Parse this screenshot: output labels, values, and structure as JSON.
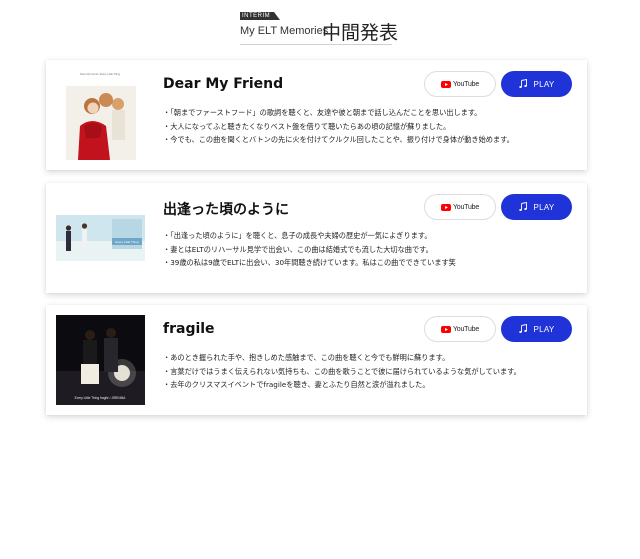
{
  "header": {
    "tag": "INTERIM",
    "subtitle": "My ELT Memories",
    "title": "中間発表"
  },
  "buttons": {
    "youtube_label": "YouTube",
    "play_label": "PLAY"
  },
  "colors": {
    "play_button": "#1f33d9",
    "youtube_red": "#ff0000"
  },
  "songs": [
    {
      "title": "Dear My Friend",
      "jacket_caption": "Dear My Friend / Every Little Thing",
      "memories": [
        "・「朝までファーストフード」の歌詞を聴くと、友達や彼と朝まで話し込んだことを思い出します。",
        "・大人になってふと聴きたくなりベスト盤を借りて聴いたらあの頃の記憶が蘇りました。",
        "・今でも、この曲を聞くとバトンの先に火を付けてクルクル回したことや、振り付けで身体が動き始めます。"
      ]
    },
    {
      "title": "出逢った頃のように",
      "jacket_caption": "Every Little Thing",
      "memories": [
        "・「出逢った頃のように」を聴くと、息子の成長や夫婦の歴史が一気によぎります。",
        "・妻とはELTのリハーサル見学で出会い、この曲は結婚式でも流した大切な曲です。",
        "・39歳の私は9歳でELTに出会い、30年間聴き続けています。私はこの曲でできています笑"
      ]
    },
    {
      "title": "fragile",
      "jacket_caption": "Every Little Thing fragile / JIRENMA",
      "memories": [
        "・あのとき握られた手や、抱きしめた感触まで、この曲を聴くと今でも鮮明に蘇ります。",
        "・言葉だけではうまく伝えられない気持ちも、この曲を歌うことで彼に届けられているような気がしています。",
        "・去年のクリスマスイベントでfragileを聴き、妻とふたり自然と涙が溢れました。"
      ]
    }
  ]
}
